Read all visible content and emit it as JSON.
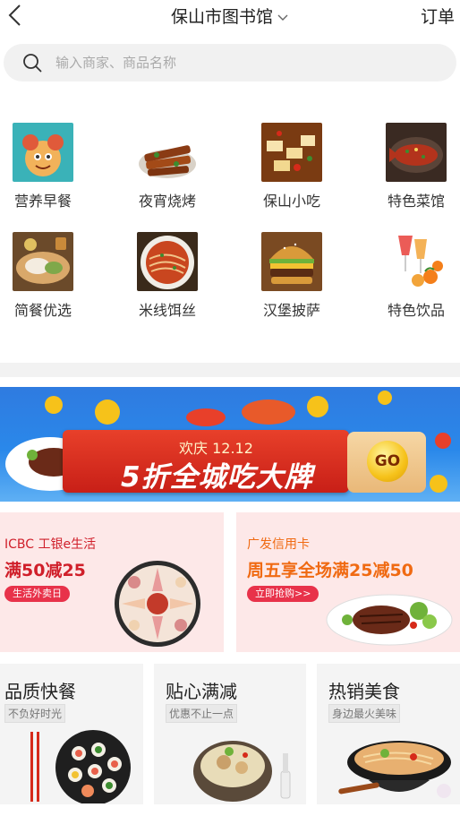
{
  "header": {
    "title": "保山市图书馆",
    "order_label": "订单"
  },
  "search": {
    "placeholder": "输入商家、商品名称",
    "value": ""
  },
  "categories": [
    {
      "label": "营养早餐",
      "icon": "breakfast-image"
    },
    {
      "label": "夜宵烧烤",
      "icon": "bbq-image"
    },
    {
      "label": "保山小吃",
      "icon": "snack-image"
    },
    {
      "label": "特色菜馆",
      "icon": "fish-dish-image"
    },
    {
      "label": "简餐优选",
      "icon": "simple-meal-image"
    },
    {
      "label": "米线饵丝",
      "icon": "noodle-image"
    },
    {
      "label": "汉堡披萨",
      "icon": "burger-image"
    },
    {
      "label": "特色饮品",
      "icon": "drink-image"
    }
  ],
  "banner": {
    "subtitle": "欢庆 12.12",
    "headline": "5折全城吃大牌",
    "go_label": "GO"
  },
  "promos": [
    {
      "line1": "ICBC 工银e生活",
      "line2": "满50减25",
      "button": "生活外卖日",
      "accent": "#d01f2a"
    },
    {
      "line1": "广发信用卡",
      "line2": "周五享全场满25减50",
      "button": "立即抢购>>",
      "accent": "#f06a12"
    }
  ],
  "cards": [
    {
      "title": "品质快餐",
      "subtitle": "不负好时光"
    },
    {
      "title": "贴心满减",
      "subtitle": "优惠不止一点"
    },
    {
      "title": "热销美食",
      "subtitle": "身边最火美味"
    }
  ],
  "colors": {
    "primary_red": "#e8324a",
    "banner_blue": "#2a88ea"
  }
}
